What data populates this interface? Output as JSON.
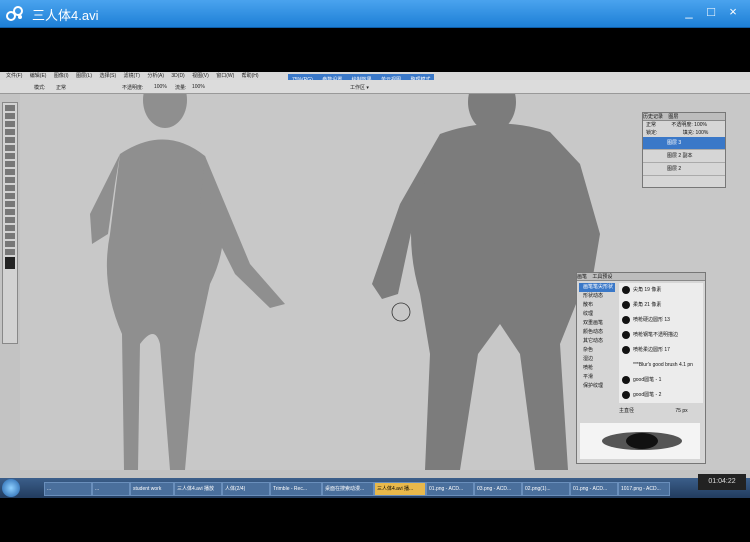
{
  "window": {
    "title": "三人体4.avi",
    "controls": [
      "_",
      "□",
      "×"
    ]
  },
  "photoshop": {
    "menu": [
      "文件(F)",
      "编辑(E)",
      "图像(I)",
      "图层(L)",
      "选择(S)",
      "滤镜(T)",
      "分析(A)",
      "3D(D)",
      "视图(V)",
      "窗口(W)",
      "帮助(H)"
    ],
    "tabs": [
      "75%(RG)",
      "参数设置",
      "绘制效果",
      "单元视图",
      "整理模式"
    ],
    "options": {
      "mode_label": "模式:",
      "mode_value": "正常",
      "opacity_label": "不透明度:",
      "opacity_value": "100%",
      "flow_label": "流量:",
      "flow_value": "100%"
    },
    "workspace": "工作区 ▾",
    "layers_panel": {
      "tabs": [
        "历史记录",
        "图层"
      ],
      "blend": "正常",
      "opacity": "不透明度: 100%",
      "lock": "锁定:",
      "fill": "填充: 100%",
      "layers": [
        "图层 3",
        "图层 2 副本",
        "图层 2"
      ]
    },
    "brush_panel": {
      "tabs": [
        "画笔",
        "工具预设"
      ],
      "options": [
        "画笔笔尖形状",
        "形状动态",
        "散布",
        "纹理",
        "双重画笔",
        "颜色动态",
        "其它动态",
        "杂色",
        "湿边",
        "喷枪",
        "平滑",
        "保护纹理"
      ],
      "brushes": [
        "尖角 19 像素",
        "柔角 21 像素",
        "喷枪硬边圆形 13",
        "喷枪钢笔不透明描边",
        "喷枪柔边圆形 17",
        "***Blur's good brush 4.1 pn",
        "good圆笔 - 1",
        "good圆笔 - 2"
      ],
      "master_diameter_label": "主直径",
      "master_diameter_value": "75 px"
    }
  },
  "taskbar": {
    "items": [
      "...",
      "...",
      "student work",
      "三人体4.avi 播放",
      "人体(2/4)",
      "Trimble - Rec...",
      "桌面在搜索动漫...",
      "三人体4.avi 播...",
      "01.png - ACD...",
      "03.png - ACD...",
      "02.png(1)...",
      "01.png - ACD...",
      "1017.png - ACD..."
    ],
    "clock": "01:04:22"
  }
}
